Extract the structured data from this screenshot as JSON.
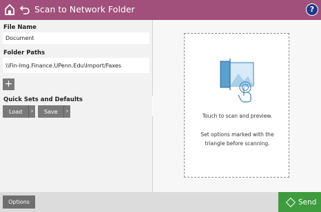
{
  "header": {
    "title": "Scan to Network Folder",
    "help_label": "?",
    "color": "#a0507a"
  },
  "file_name": {
    "label": "File Name",
    "value": "Document"
  },
  "folder_paths": {
    "label": "Folder Paths",
    "value": "\\\\Fin-Img.Finance.UPenn.Edu\\Import/Faxes",
    "add_label": "+"
  },
  "quick_sets": {
    "label": "Quick Sets and Defaults",
    "load_label": "Load",
    "save_label": "Save"
  },
  "preview": {
    "line1": "Touch to scan and preview.",
    "line2": "Set options marked with the",
    "line3": "triangle before scanning."
  },
  "footer": {
    "options_label": "Options",
    "send_label": "Send",
    "send_color": "#3e9c3e"
  },
  "icons": {
    "home": "home-icon",
    "back": "back-arrow-icon",
    "help": "help-icon",
    "collapse": "chevron-left-icon",
    "preview": "touch-preview-icon",
    "send": "send-diamond-icon"
  }
}
